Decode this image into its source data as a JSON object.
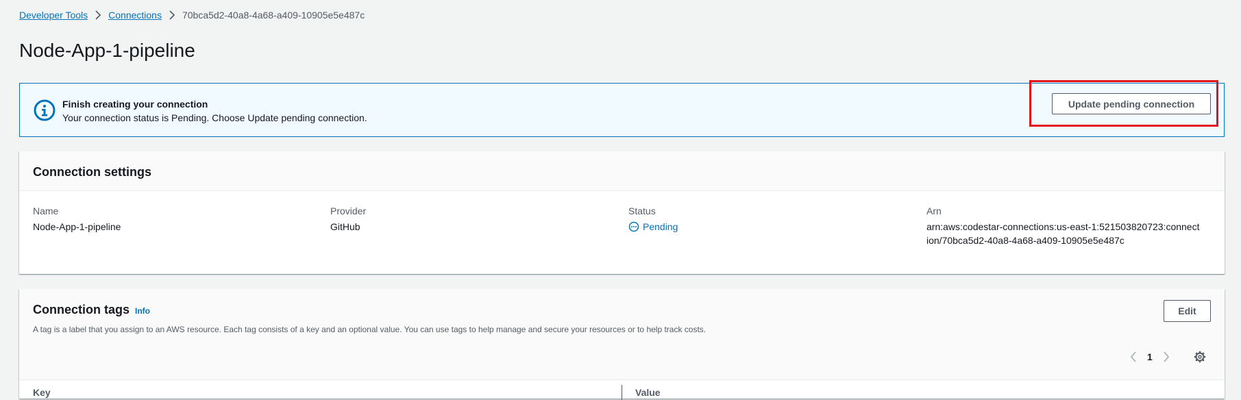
{
  "breadcrumb": {
    "items": [
      "Developer Tools",
      "Connections"
    ],
    "current": "70bca5d2-40a8-4a68-a409-10905e5e487c"
  },
  "page": {
    "title": "Node-App-1-pipeline"
  },
  "alert": {
    "title": "Finish creating your connection",
    "body": "Your connection status is Pending. Choose Update pending connection.",
    "button_label": "Update pending connection",
    "icon": "info-icon"
  },
  "settings": {
    "title": "Connection settings",
    "fields": [
      {
        "label": "Name",
        "value": "Node-App-1-pipeline"
      },
      {
        "label": "Provider",
        "value": "GitHub"
      },
      {
        "label": "Status",
        "value": "Pending",
        "icon": "status-pending-icon"
      },
      {
        "label": "Arn",
        "value": "arn:aws:codestar-connections:us-east-1:521503820723:connection/70bca5d2-40a8-4a68-a409-10905e5e487c"
      }
    ]
  },
  "tags": {
    "title": "Connection tags",
    "info_label": "Info",
    "description": "A tag is a label that you assign to an AWS resource. Each tag consists of a key and an optional value. You can use tags to help manage and secure your resources or to help track costs.",
    "edit_label": "Edit",
    "page": "1",
    "columns": [
      "Key",
      "Value"
    ]
  },
  "colors": {
    "link": "#0073bb",
    "alert_bg": "#f1faff",
    "alert_border": "#0073bb",
    "highlight": "#e3121b",
    "page_bg": "#f2f3f3"
  }
}
